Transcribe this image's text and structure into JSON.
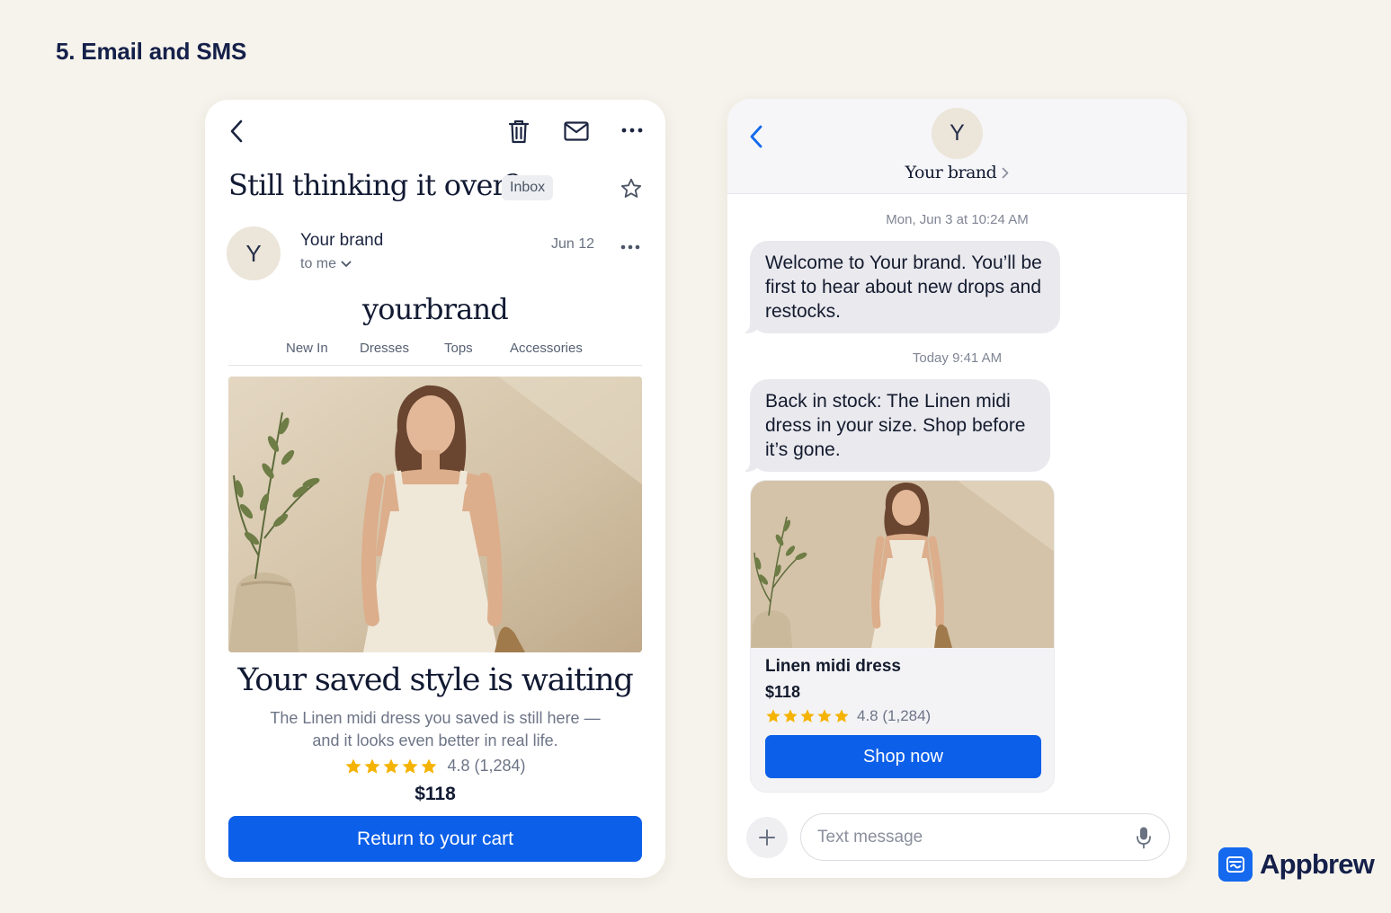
{
  "page": {
    "section_title": "5. Email and SMS"
  },
  "email": {
    "subject": "Still thinking it over?",
    "folder_badge": "Inbox",
    "sender_initial": "Y",
    "sender_name": "Your brand",
    "recipient": "to me",
    "date": "Jun 12",
    "brand_logo_text": "yourbrand",
    "nav": [
      "New In",
      "Dresses",
      "Tops",
      "Accessories"
    ],
    "headline": "Your saved style is waiting",
    "body_line1": "The Linen midi dress you saved is still here —",
    "body_line2": "and it looks even better in real life.",
    "rating_text": "4.8 (1,284)",
    "rating_stars": 5,
    "price": "$118",
    "cta_label": "Return to your cart",
    "icons": [
      "back-arrow-icon",
      "trash-icon",
      "mail-icon",
      "more-icon",
      "star-icon",
      "chevron-down-icon"
    ]
  },
  "sms": {
    "contact_initial": "Y",
    "contact_name": "Your brand",
    "messages": [
      {
        "timestamp": "Mon, Jun 3 at 10:24 AM",
        "text": "Welcome to Your brand. You’ll be first to hear about new drops and restocks."
      },
      {
        "timestamp": "Today 9:41 AM",
        "text": "Back in stock: The Linen midi dress in your size. Shop before it’s gone."
      }
    ],
    "product": {
      "title": "Linen midi dress",
      "price": "$118",
      "rating_text": "4.8 (1,284)",
      "rating_stars": 5,
      "cta_label": "Shop now"
    },
    "input_placeholder": "Text message",
    "icons": [
      "back-arrow-icon",
      "chevron-right-icon",
      "plus-icon",
      "microphone-icon"
    ]
  },
  "brand": {
    "name": "Appbrew"
  },
  "colors": {
    "background": "#f6f3ec",
    "accent_blue": "#0c5fe8",
    "star_yellow": "#f5b301",
    "ink": "#121a33",
    "bubble_gray": "#e9e9ee"
  }
}
